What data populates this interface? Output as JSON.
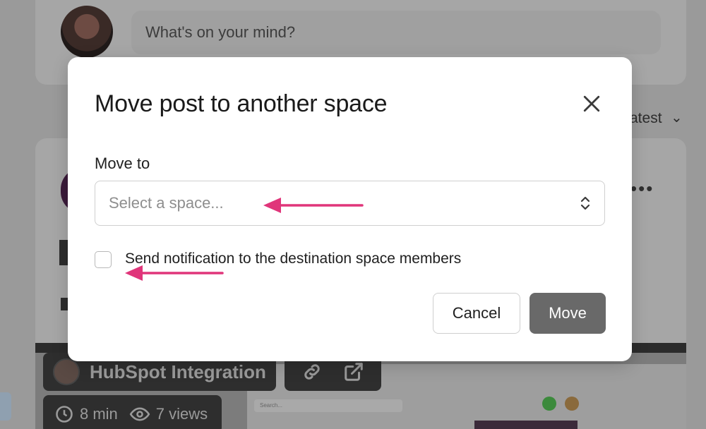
{
  "background": {
    "composer_placeholder": "What's on your mind?",
    "sort_label": "Latest",
    "sort_label_visible": "atest",
    "video_title": "HubSpot Integration",
    "video_duration": "8 min",
    "video_views": "7 views",
    "video_search_placeholder": "Search..."
  },
  "modal": {
    "title": "Move post to another space",
    "field_label": "Move to",
    "select_placeholder": "Select a space...",
    "checkbox_label": "Send notification to the destination space members",
    "checkbox_checked": false,
    "cancel_label": "Cancel",
    "move_label": "Move"
  },
  "colors": {
    "annotation_arrow": "#e0357a",
    "move_button": "#696969",
    "backdrop": "#9a9a9a"
  },
  "icons": {
    "close": "close-icon",
    "select_chevron": "chevron-up-down-icon",
    "link": "link-icon",
    "external": "external-link-icon",
    "clock": "clock-icon",
    "eye": "eye-icon"
  }
}
